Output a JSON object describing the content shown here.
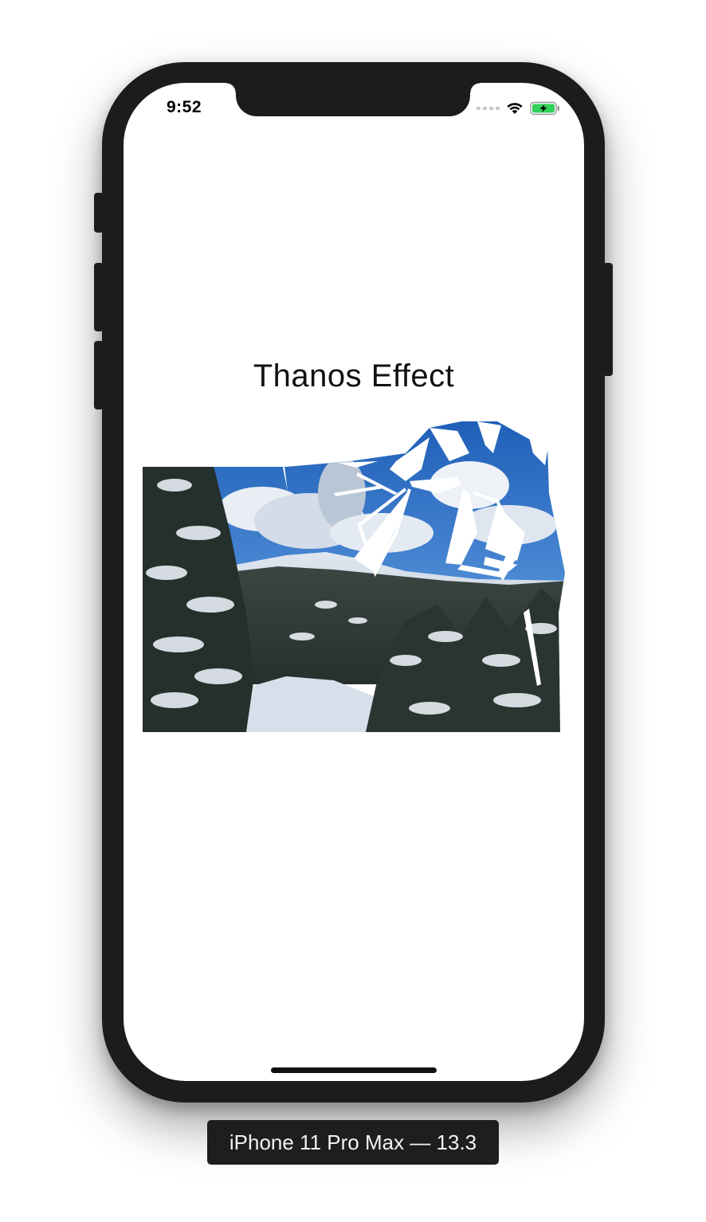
{
  "status_bar": {
    "time": "9:52",
    "icons": [
      "cellular-dots-icon",
      "wifi-icon",
      "battery-charging-icon"
    ],
    "battery_color": "#30d158"
  },
  "app": {
    "title": "Thanos Effect",
    "image": {
      "subject": "snowy-forest-mountain-photo",
      "effect": "shattered-fragments"
    }
  },
  "simulator": {
    "device_label": "iPhone 11 Pro Max — 13.3"
  },
  "colors": {
    "frame": "#1c1c1c",
    "screen": "#ffffff",
    "sky": "#2f6fc0",
    "snow": "#eef2f7",
    "tree_dark": "#1f2a28"
  }
}
